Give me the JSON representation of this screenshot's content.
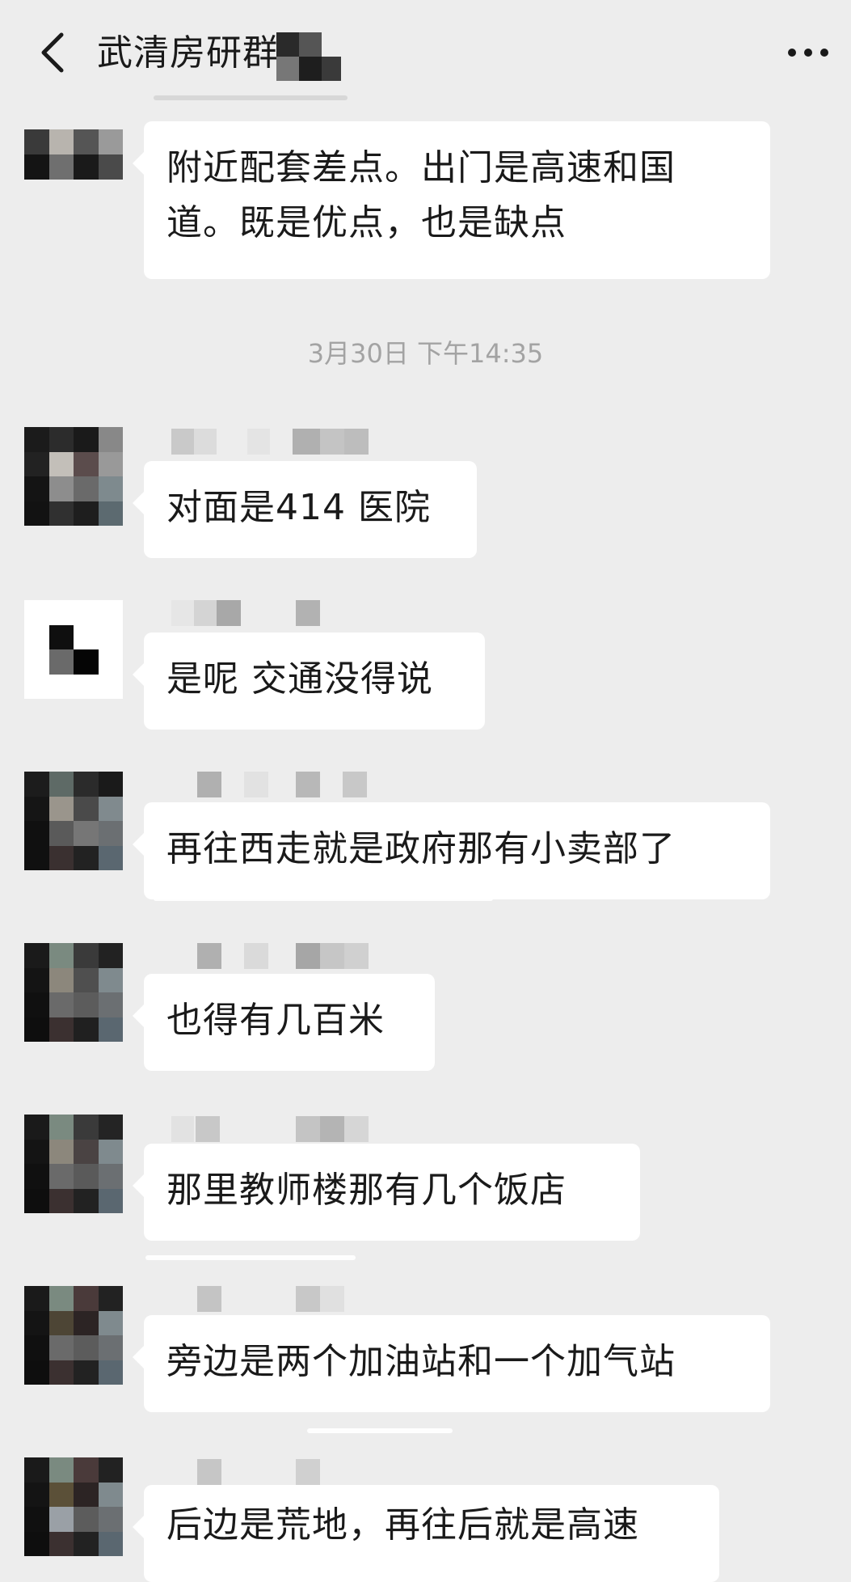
{
  "header": {
    "title": "武清房研群",
    "back_icon": "chevron-left-icon",
    "more_icon": "ellipsis-icon"
  },
  "timestamp": "3月30日 下午14:35",
  "messages": [
    {
      "text": "附近配套差点。出门是高速和国道。既是优点，也是缺点"
    },
    {
      "text": "对面是414 医院"
    },
    {
      "text": "是呢 交通没得说"
    },
    {
      "text": "再往西走就是政府那有小卖部了"
    },
    {
      "text": "也得有几百米"
    },
    {
      "text": "那里教师楼那有几个饭店"
    },
    {
      "text": "旁边是两个加油站和一个加气站"
    },
    {
      "text": "后边是荒地，再往后就是高速"
    }
  ]
}
